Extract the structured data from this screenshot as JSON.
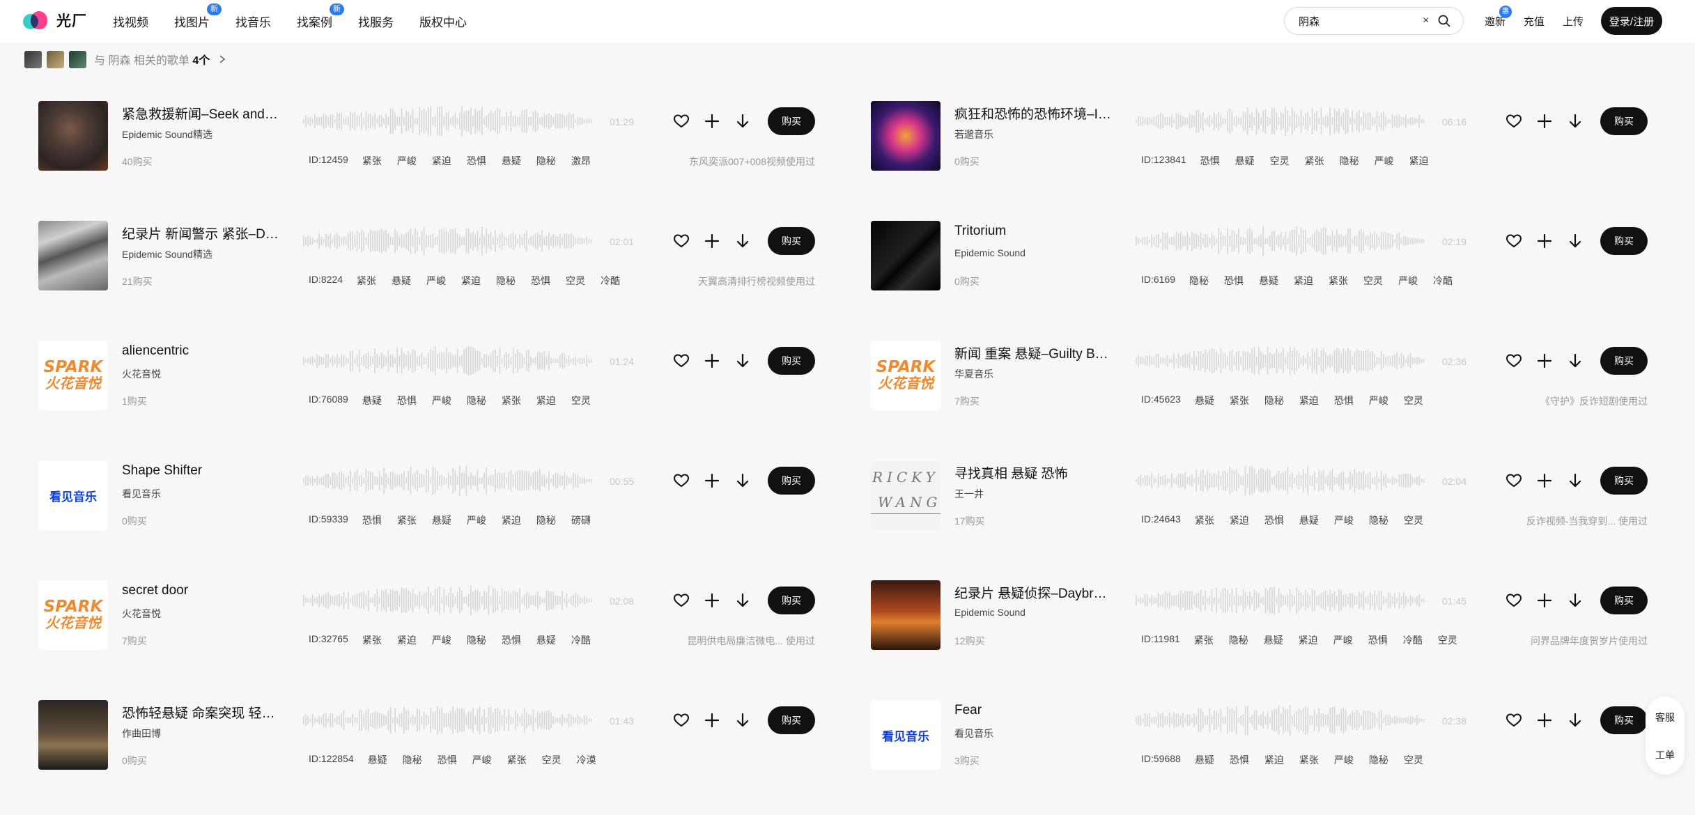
{
  "brand": {
    "name": "光厂"
  },
  "nav": [
    {
      "label": "找视频",
      "badge": ""
    },
    {
      "label": "找图片",
      "badge": "新"
    },
    {
      "label": "找音乐",
      "badge": ""
    },
    {
      "label": "找案例",
      "badge": "新"
    },
    {
      "label": "找服务",
      "badge": ""
    },
    {
      "label": "版权中心",
      "badge": ""
    }
  ],
  "search": {
    "value": "阴森",
    "clear": "×"
  },
  "header_links": {
    "invite": "邀新",
    "invite_badge": "惠",
    "recharge": "充值",
    "upload": "上传",
    "login": "登录/注册"
  },
  "related": {
    "prefix": "与 阴森 相关的歌单",
    "count": "4个"
  },
  "icons": {
    "favorite": "heart-icon",
    "add": "plus-icon",
    "download": "download-arrow-icon",
    "search": "search-icon",
    "chevron": "chevron-right-icon"
  },
  "buy_label": "购买",
  "tracks": [
    {
      "title": "紧急救援新闻–Seek and Rescue",
      "artist": "Epidemic Sound精选",
      "sales": "40购买",
      "duration": "01:29",
      "id": "ID:12459",
      "tags": [
        "紧张",
        "严峻",
        "紧迫",
        "恐惧",
        "悬疑",
        "隐秘",
        "激昂"
      ],
      "usage": "东风奕派007+008视频使用过",
      "cover": "explosion"
    },
    {
      "title": "疯狂和恐怖的恐怖环境–Insanity",
      "artist": "若邈音乐",
      "sales": "0购买",
      "duration": "06:16",
      "id": "ID:123841",
      "tags": [
        "恐惧",
        "悬疑",
        "空灵",
        "紧张",
        "隐秘",
        "严峻",
        "紧迫"
      ],
      "usage": "",
      "cover": "neon"
    },
    {
      "title": "纪录片 新闻警示 紧张–Dark Tension",
      "artist": "Epidemic Sound精选",
      "sales": "21购买",
      "duration": "02:01",
      "id": "ID:8224",
      "tags": [
        "紧张",
        "悬疑",
        "严峻",
        "紧迫",
        "隐秘",
        "恐惧",
        "空灵",
        "冷酷"
      ],
      "usage": "天翼高清排行榜视频使用过",
      "cover": "waves"
    },
    {
      "title": "Tritorium",
      "artist": "Epidemic Sound",
      "sales": "0购买",
      "duration": "02:19",
      "id": "ID:6169",
      "tags": [
        "隐秘",
        "恐惧",
        "悬疑",
        "紧迫",
        "紧张",
        "空灵",
        "严峻",
        "冷酷"
      ],
      "usage": "",
      "cover": "dark"
    },
    {
      "title": "aliencentric",
      "artist": "火花音悦",
      "sales": "1购买",
      "duration": "01:24",
      "id": "ID:76089",
      "tags": [
        "悬疑",
        "恐惧",
        "严峻",
        "隐秘",
        "紧张",
        "紧迫",
        "空灵"
      ],
      "usage": "",
      "cover": "spark"
    },
    {
      "title": "新闻 重案 悬疑–Guilty Before Trial",
      "artist": "华夏音乐",
      "sales": "7购买",
      "duration": "02:36",
      "id": "ID:45623",
      "tags": [
        "悬疑",
        "紧张",
        "隐秘",
        "紧迫",
        "恐惧",
        "严峻",
        "空灵"
      ],
      "usage": "《守护》反诈短剧使用过",
      "cover": "spark"
    },
    {
      "title": "Shape Shifter",
      "artist": "看见音乐",
      "sales": "0购买",
      "duration": "00:55",
      "id": "ID:59339",
      "tags": [
        "恐惧",
        "紧张",
        "悬疑",
        "严峻",
        "紧迫",
        "隐秘",
        "磅礴"
      ],
      "usage": "",
      "cover": "kanjian"
    },
    {
      "title": "寻找真相 悬疑 恐怖",
      "artist": "王一井",
      "sales": "17购买",
      "duration": "02:04",
      "id": "ID:24643",
      "tags": [
        "紧张",
        "紧迫",
        "恐惧",
        "悬疑",
        "严峻",
        "隐秘",
        "空灵"
      ],
      "usage": "反诈视频-当我穿到... 使用过",
      "cover": "ricky",
      "cover_text": [
        "RICKY",
        "WANG"
      ]
    },
    {
      "title": "secret door",
      "artist": "火花音悦",
      "sales": "7购买",
      "duration": "02:08",
      "id": "ID:32765",
      "tags": [
        "紧张",
        "紧迫",
        "严峻",
        "隐秘",
        "恐惧",
        "悬疑",
        "冷酷"
      ],
      "usage": "昆明供电局廉洁微电... 使用过",
      "cover": "spark"
    },
    {
      "title": "纪录片 悬疑侦探–Daybreak",
      "artist": "Epidemic Sound",
      "sales": "12购买",
      "duration": "01:45",
      "id": "ID:11981",
      "tags": [
        "紧张",
        "隐秘",
        "悬疑",
        "紧迫",
        "严峻",
        "恐惧",
        "冷酷",
        "空灵"
      ],
      "usage": "问界品牌年度贺岁片使用过",
      "cover": "sunset"
    },
    {
      "title": "恐怖轻悬疑 命案突现 轻悬疑背景",
      "artist": "作曲田博",
      "sales": "0购买",
      "duration": "01:43",
      "id": "ID:122854",
      "tags": [
        "悬疑",
        "隐秘",
        "恐惧",
        "严峻",
        "紧张",
        "空灵",
        "冷漠"
      ],
      "usage": "",
      "cover": "book"
    },
    {
      "title": "Fear",
      "artist": "看见音乐",
      "sales": "3购买",
      "duration": "02:38",
      "id": "ID:59688",
      "tags": [
        "悬疑",
        "恐惧",
        "紧迫",
        "紧张",
        "严峻",
        "隐秘",
        "空灵"
      ],
      "usage": "",
      "cover": "kanjian"
    }
  ],
  "cover_brands": {
    "spark_1": "SPARK",
    "spark_2": "火花音悦",
    "kanjian": "看见音乐"
  },
  "side": {
    "service": "客服",
    "ticket": "工单"
  },
  "colors": {
    "accent": "#2a7cf6",
    "dark": "#111111",
    "spark": "#f08a2c",
    "kanjian": "#1240d0"
  }
}
